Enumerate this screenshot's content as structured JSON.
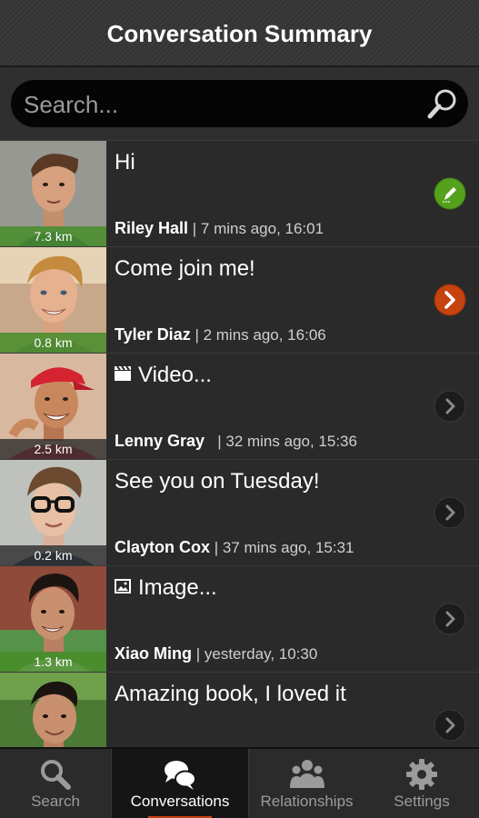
{
  "header": {
    "title": "Conversation Summary"
  },
  "search": {
    "placeholder": "Search...",
    "value": "",
    "icon": "search-icon"
  },
  "conversations": [
    {
      "message": "Hi",
      "message_icon": "",
      "name": "Riley Hall",
      "time": "| 7 mins ago, 16:01",
      "distance": "7.3 km",
      "action": "edit-icon",
      "action_color": "#55a11e"
    },
    {
      "message": "Come join me!",
      "message_icon": "",
      "name": "Tyler Diaz",
      "time": "| 2 mins ago, 16:06",
      "distance": "0.8 km",
      "action": "chevron-right-icon",
      "action_color": "#c64310"
    },
    {
      "message": "Video...",
      "message_icon": "video-icon",
      "name": "Lenny Gray",
      "time": "  | 32 mins ago, 15:36",
      "distance": "2.5 km",
      "action": "chevron-right-icon",
      "action_color": "#1c1c1c"
    },
    {
      "message": "See you on Tuesday!",
      "message_icon": "",
      "name": "Clayton Cox",
      "time": "| 37 mins ago, 15:31",
      "distance": "0.2 km",
      "action": "chevron-right-icon",
      "action_color": "#1c1c1c"
    },
    {
      "message": "Image...",
      "message_icon": "image-icon",
      "name": "Xiao Ming",
      "time": "| yesterday, 10:30",
      "distance": "1.3 km",
      "action": "chevron-right-icon",
      "action_color": "#1c1c1c"
    },
    {
      "message": "Amazing book, I loved it",
      "message_icon": "",
      "name": "",
      "time": "",
      "distance": "",
      "action": "chevron-right-icon",
      "action_color": "#1c1c1c"
    }
  ],
  "tabs": [
    {
      "label": "Search",
      "icon": "search-icon",
      "active": false
    },
    {
      "label": "Conversations",
      "icon": "chat-bubbles-icon",
      "active": true
    },
    {
      "label": "Relationships",
      "icon": "people-icon",
      "active": false
    },
    {
      "label": "Settings",
      "icon": "gear-icon",
      "active": false
    }
  ],
  "colors": {
    "accent": "#c64310",
    "online": "#55a11e",
    "background": "#262626"
  }
}
